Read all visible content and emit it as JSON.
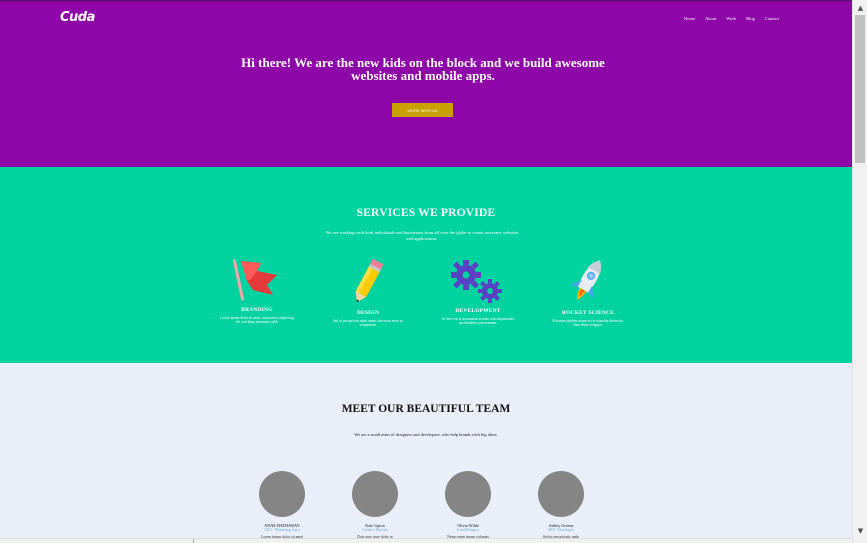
{
  "header": {
    "logo": "Cuda",
    "nav": [
      "Home",
      "About",
      "Work",
      "Blog",
      "Contact"
    ]
  },
  "hero": {
    "title": "Hi there! We are the new kids on the block and we build awesome websites and mobile apps.",
    "button_label": "WORK WITH US"
  },
  "services": {
    "title": "SERVICES WE PROVIDE",
    "subtitle": "We are working with both individuals and businesses from all over the globe to create awesome websites and applications.",
    "items": [
      {
        "name": "BRANDING",
        "desc": "Lorem ipsum dolor sit amet, consectetur adipiscing elit, sed diam nonummy nibh.",
        "icon": "flag-icon"
      },
      {
        "name": "DESIGN",
        "desc": "Sed ut perspiciatis unde omnis iste natus error sit voluptatem.",
        "icon": "pencil-icon"
      },
      {
        "name": "DEVELOPMENT",
        "desc": "At vero eos et accusamus et iusto odio dignissimos qui blanditiis praesentium.",
        "icon": "gears-icon"
      },
      {
        "name": "ROCKET SCIENCE",
        "desc": "Et harum quidem rerum est et expedita distinctio. Nam libero tempore.",
        "icon": "rocket-icon"
      }
    ]
  },
  "team": {
    "title": "MEET OUR BEAUTIFUL TEAM",
    "subtitle": "We are a small team of designers and developers, who help brands with big ideas.",
    "members": [
      {
        "name": "ANNE HATHAWAY",
        "role": "CEO / Marketing Guru",
        "desc": "Lorem ipsum dolor sit amet"
      },
      {
        "name": "Kate Upton",
        "role": "Creative Director",
        "desc": "Duis aute irure dolor in"
      },
      {
        "name": "Olivia Wilde",
        "role": "Lead Designer",
        "desc": "Nemo enim ipsam voluptas"
      },
      {
        "name": "Ashley Greene",
        "role": "SEO / Developer",
        "desc": "Sed ut perspiciatis unde"
      }
    ]
  },
  "colors": {
    "hero_bg": "#8e05a8",
    "button": "#c9a100",
    "services_bg": "#00d2a0",
    "team_bg": "#e9eef8",
    "avatar": "#858585"
  }
}
